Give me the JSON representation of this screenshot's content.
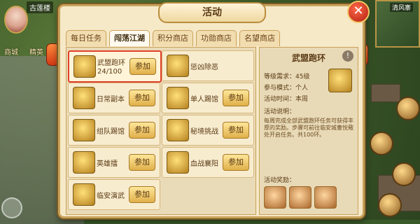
{
  "hud": {
    "player_name": "古莲楼",
    "btn_shop": "商城",
    "btn_elite": "精英",
    "minimap_label": "清风寨"
  },
  "panel": {
    "title": "活动",
    "close": "✕"
  },
  "tabs": [
    {
      "label": "每日任务"
    },
    {
      "label": "闯荡江湖"
    },
    {
      "label": "积分商店"
    },
    {
      "label": "功勋商店"
    },
    {
      "label": "名望商店"
    }
  ],
  "activities": [
    {
      "name": "武盟跑环",
      "progress": "24/100",
      "button": "参加"
    },
    {
      "name": "惩凶除恶",
      "button": ""
    },
    {
      "name": "日常副本",
      "button": "参加"
    },
    {
      "name": "单人踢馆",
      "button": "参加"
    },
    {
      "name": "组队踢馆",
      "button": "参加"
    },
    {
      "name": "秘境挑战",
      "button": "参加"
    },
    {
      "name": "英雄擂",
      "button": "参加"
    },
    {
      "name": "血战襄阳",
      "button": "参加"
    },
    {
      "name": "临安演武",
      "button": "参加"
    }
  ],
  "detail": {
    "title": "武盟跑环",
    "info": "!",
    "level_label": "等级需求：",
    "level_value": "45级",
    "mode_label": "参与模式：",
    "mode_value": "个人",
    "time_label": "活动时间：",
    "time_value": "本周",
    "desc_label": "活动说明：",
    "desc_text": "每周完成全部武盟跑环任务可获得丰厚的奖励。步骤可前往临安城曹悦儆处开启任务。共100环。",
    "rewards_label": "活动奖励："
  },
  "colors": {
    "panel_bg": "#f6e9c8",
    "panel_border": "#c7a25a",
    "selected_border": "#e0402a",
    "join_btn": "#e0b04a"
  }
}
